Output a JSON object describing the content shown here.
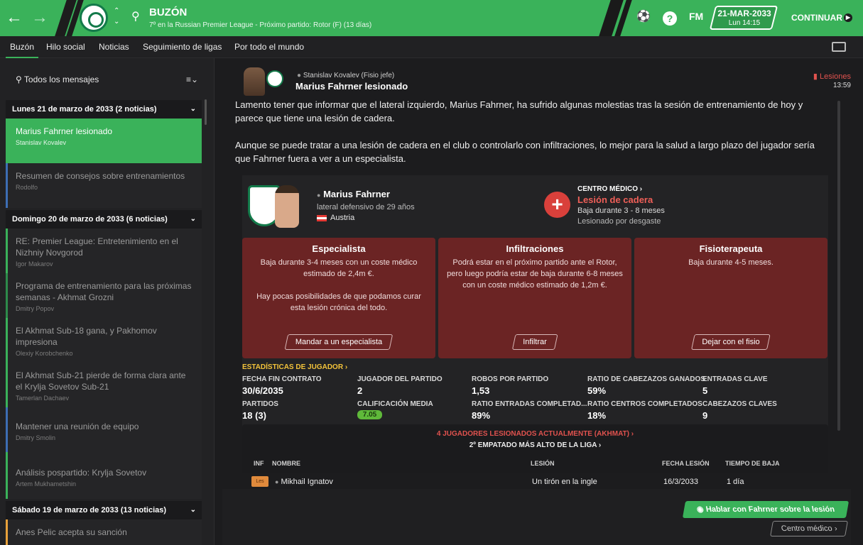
{
  "header": {
    "title": "BUZÓN",
    "subtitle": "7º en la Russian Premier League - Próximo partido: Rotor (F) (13 días)",
    "fm_label": "FM",
    "date": "21-MAR-2033",
    "day_time": "Lun 14:15",
    "continue_label": "CONTINUAR"
  },
  "tabs": [
    "Buzón",
    "Hilo social",
    "Noticias",
    "Seguimiento de ligas",
    "Por todo el mundo"
  ],
  "sidebar": {
    "search_label": "Todos los mensajes",
    "groups": [
      {
        "label": "Lunes 21 de marzo de 2033 (2 noticias)"
      },
      {
        "label": "Domingo 20 de marzo de 2033 (6 noticias)"
      },
      {
        "label": "Sábado 19 de marzo de 2033 (13 noticias)"
      }
    ],
    "messages": [
      {
        "title": "Marius Fahrner lesionado",
        "sender": "Stanislav Kovalev"
      },
      {
        "title": "Resumen de consejos sobre entrenamientos",
        "sender": "Rodolfo"
      },
      {
        "title": "RE: Premier League: Entretenimiento en el Nizhniy Novgorod",
        "sender": "Igor Makarov"
      },
      {
        "title": "Programa de entrenamiento para las próximas semanas - Akhmat Grozni",
        "sender": "Dmitry Popov"
      },
      {
        "title": "El Akhmat Sub-18 gana, y Pakhomov impresiona",
        "sender": "Olexiy Korobchenko"
      },
      {
        "title": "El Akhmat Sub-21 pierde de forma clara ante el Krylja Sovetov Sub-21",
        "sender": "Tamerlan Dachaev"
      },
      {
        "title": "Mantener una reunión de equipo",
        "sender": "Dmitry Smolin"
      },
      {
        "title": "Análisis pospartido: Krylja Sovetov",
        "sender": "Artem Mukhametshin"
      },
      {
        "title": "Anes Pelic acepta su sanción",
        "sender": ""
      }
    ]
  },
  "message": {
    "sender": "Stanislav Kovalev (Fisio jefe)",
    "subject": "Marius Fahrner lesionado",
    "tag": "Lesiones",
    "time": "13:59",
    "paragraph1": "Lamento tener que informar que el lateral izquierdo, Marius Fahrner, ha sufrido algunas molestias tras la sesión de entrenamiento de hoy y parece que tiene una lesión de cadera.",
    "paragraph2": "Aunque se puede tratar a una lesión de cadera en el club o controlarlo con infiltraciones, lo mejor para la salud a largo plazo del jugador sería que Fahrner fuera a ver a un especialista."
  },
  "player": {
    "name": "Marius Fahrner",
    "role": "lateral defensivo de 29 años",
    "country": "Austria"
  },
  "medical": {
    "header": "CENTRO MÉDICO ›",
    "injury": "Lesión de cadera",
    "duration": "Baja durante 3 - 8 meses",
    "cause": "Lesionado por desgaste"
  },
  "options": [
    {
      "title": "Especialista",
      "desc": "Baja durante 3-4 meses con un coste médico estimado de 2,4m €.",
      "desc2": "Hay pocas posibilidades de que podamos curar esta lesión crónica del todo.",
      "button": "Mandar a un especialista"
    },
    {
      "title": "Infiltraciones",
      "desc": "Podrá estar en el próximo partido ante el Rotor, pero luego podría estar de baja durante 6-8 meses con un coste médico estimado de 1,2m €.",
      "desc2": "",
      "button": "Infiltrar"
    },
    {
      "title": "Fisioterapeuta",
      "desc": "Baja durante 4-5 meses.",
      "desc2": "",
      "button": "Dejar con el fisio"
    }
  ],
  "stats": {
    "title": "ESTADÍSTICAS DE JUGADOR ›",
    "items": [
      {
        "label": "FECHA FIN CONTRATO",
        "value": "30/6/2035"
      },
      {
        "label": "JUGADOR DEL PARTIDO",
        "value": "2"
      },
      {
        "label": "ROBOS POR PARTIDO",
        "value": "1,53"
      },
      {
        "label": "RATIO DE CABEZAZOS GANADOS",
        "value": "59%"
      },
      {
        "label": "ENTRADAS CLAVE",
        "value": "5"
      },
      {
        "label": "PARTIDOS",
        "value": "18 (3)"
      },
      {
        "label": "CALIFICACIÓN MEDIA",
        "value": "7.05"
      },
      {
        "label": "RATIO ENTRADAS COMPLETAD...",
        "value": "89%"
      },
      {
        "label": "RATIO CENTROS COMPLETADOS",
        "value": "18%"
      },
      {
        "label": "CABEZAZOS CLAVES",
        "value": "9"
      }
    ]
  },
  "injuries": {
    "title": "4 JUGADORES LESIONADOS ACTUALMENTE (AKHMAT) ›",
    "subtitle": "2º EMPATADO MÁS ALTO DE LA LIGA ›",
    "columns": [
      "INF",
      "NOMBRE",
      "LESIÓN",
      "FECHA LESIÓN",
      "TIEMPO DE BAJA"
    ],
    "rows": [
      {
        "badge": "Les",
        "name": "Mikhail Ignatov",
        "injury": "Un tirón en la ingle",
        "date": "16/3/2033",
        "time": "1 día"
      }
    ]
  },
  "actions": {
    "talk": "Hablar con Fahrner sobre la lesión",
    "medical": "Centro médico"
  }
}
